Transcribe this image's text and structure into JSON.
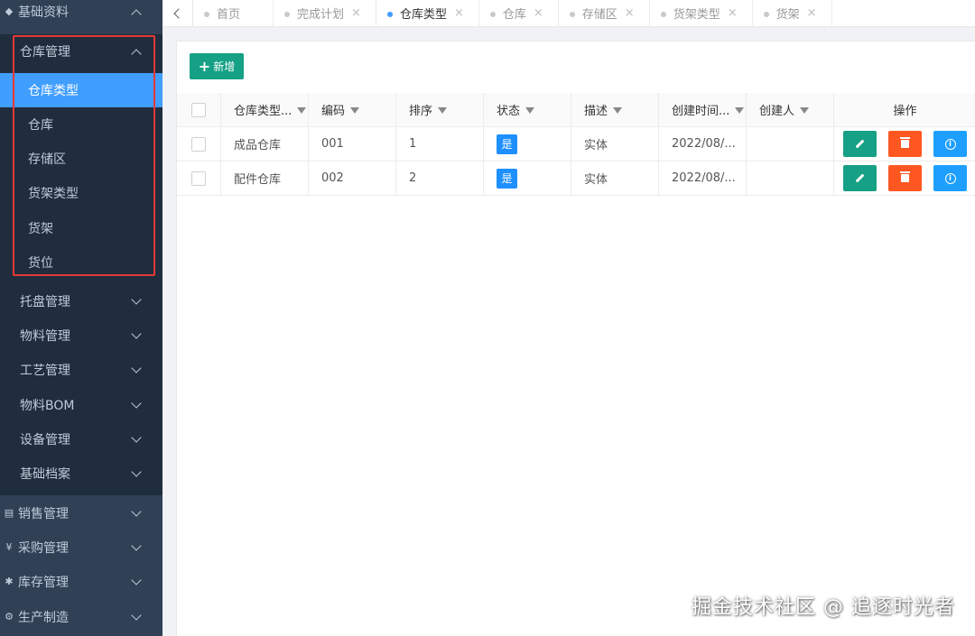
{
  "sidebar": {
    "top": {
      "label": "基础资料",
      "icon": "shield-icon"
    },
    "group": {
      "label": "仓库管理"
    },
    "leaves": [
      "仓库类型",
      "仓库",
      "存储区",
      "货架类型",
      "货架",
      "货位"
    ],
    "groups_collapsed": [
      "托盘管理",
      "物料管理",
      "工艺管理",
      "物料BOM",
      "设备管理",
      "基础档案"
    ],
    "sections": [
      {
        "label": "销售管理",
        "icon": "cart-icon"
      },
      {
        "label": "采购管理",
        "icon": "yen-icon"
      },
      {
        "label": "库存管理",
        "icon": "gear-icon"
      },
      {
        "label": "生产制造",
        "icon": "factory-icon"
      }
    ]
  },
  "tabs": [
    {
      "label": "首页",
      "closable": false
    },
    {
      "label": "完成计划",
      "closable": true
    },
    {
      "label": "仓库类型",
      "closable": true,
      "active": true
    },
    {
      "label": "仓库",
      "closable": true
    },
    {
      "label": "存储区",
      "closable": true
    },
    {
      "label": "货架类型",
      "closable": true
    },
    {
      "label": "货架",
      "closable": true
    }
  ],
  "toolbar": {
    "add_label": "新增"
  },
  "table": {
    "headers": [
      "仓库类型...",
      "编码",
      "排序",
      "状态",
      "描述",
      "创建时间...",
      "创建人",
      "操作"
    ],
    "rows": [
      {
        "name": "成品仓库",
        "code": "001",
        "sort": "1",
        "status": "是",
        "desc": "实体",
        "created": "2022/08/...",
        "creator": ""
      },
      {
        "name": "配件仓库",
        "code": "002",
        "sort": "2",
        "status": "是",
        "desc": "实体",
        "created": "2022/08/...",
        "creator": ""
      }
    ]
  },
  "watermark": "掘金技术社区 @ 追逐时光者",
  "colors": {
    "sidebar": "#304156",
    "submenu": "#1f2d3d",
    "active": "#409eff",
    "edit": "#16a085",
    "delete": "#ff5722",
    "info": "#1e9fff"
  }
}
